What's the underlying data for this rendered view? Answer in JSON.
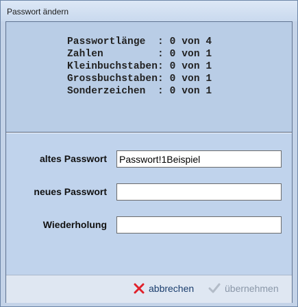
{
  "window": {
    "title": "Passwort ändern"
  },
  "rules": [
    "Passwortlänge  : 0 von 4",
    "Zahlen         : 0 von 1",
    "Kleinbuchstaben: 0 von 1",
    "Grossbuchstaben: 0 von 1",
    "Sonderzeichen  : 0 von 1"
  ],
  "form": {
    "old_password": {
      "label": "altes Passwort",
      "value": "Passwort!1Beispiel"
    },
    "new_password": {
      "label": "neues Passwort",
      "value": ""
    },
    "repeat_password": {
      "label": "Wiederholung",
      "value": ""
    }
  },
  "buttons": {
    "cancel": {
      "label": "abbrechen",
      "icon": "close-icon",
      "color": "#e0202a"
    },
    "apply": {
      "label": "übernehmen",
      "icon": "check-icon",
      "enabled": false
    }
  }
}
